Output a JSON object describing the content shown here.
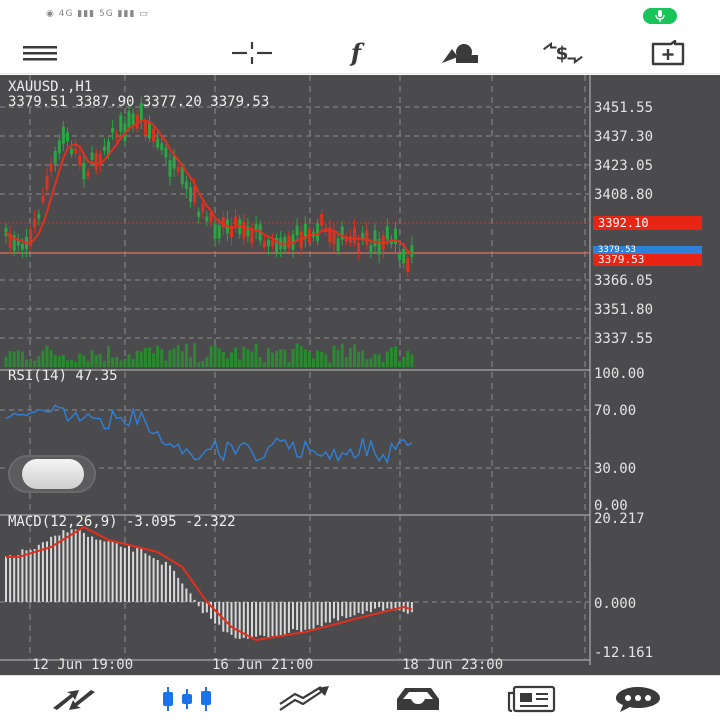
{
  "status_bar": {
    "left_text": "◉ 4G ▮▮▮ 5G ▮▮▮ ▭"
  },
  "colors": {
    "background": "#4b4a4c",
    "grid": "#8d8c8f",
    "bull_candle": "#28a745",
    "bear_candle": "#e0301e",
    "ma_line": "#e0301e",
    "rsi_line": "#2f80d8",
    "volume": "#2a8a2f",
    "macd_hist": "#d8d8d8",
    "active_nav": "#1a73e8",
    "icon": "#3a3a3a"
  },
  "toolbar": {
    "items": [
      {
        "name": "menu-icon"
      },
      {
        "name": "crosshair-icon"
      },
      {
        "name": "indicators-icon",
        "glyph": "f"
      },
      {
        "name": "objects-icon"
      },
      {
        "name": "symbol-change-icon",
        "glyph": "$"
      },
      {
        "name": "new-order-icon"
      }
    ]
  },
  "chart": {
    "symbol_line": "XAUUSD.,H1",
    "ohlc_line": "3379.51 3387.90 3377.20 3379.53",
    "price_axis": [
      "3451.55",
      "3437.30",
      "3423.05",
      "3408.80",
      "3366.05",
      "3351.80",
      "3337.55"
    ],
    "price_tags": {
      "ask": "3392.10",
      "last": "3379.53",
      "bid": "3379.53"
    },
    "rsi": {
      "title": "RSI(14) 47.35",
      "levels": [
        "100.00",
        "70.00",
        "30.00",
        "0.00"
      ]
    },
    "macd": {
      "title": "MACD(12,26,9) -3.095 -2.322",
      "levels": [
        "20.217",
        "0.000",
        "-12.161"
      ]
    },
    "time_axis": [
      "12 Jun 19:00",
      "16 Jun 21:00",
      "18 Jun 23:00"
    ]
  },
  "bottom_nav": {
    "items": [
      {
        "name": "quotes-icon",
        "active": false
      },
      {
        "name": "chart-icon",
        "active": true
      },
      {
        "name": "trade-icon",
        "active": false
      },
      {
        "name": "history-icon",
        "active": false
      },
      {
        "name": "news-icon",
        "active": false
      },
      {
        "name": "messages-icon",
        "active": false
      }
    ]
  }
}
